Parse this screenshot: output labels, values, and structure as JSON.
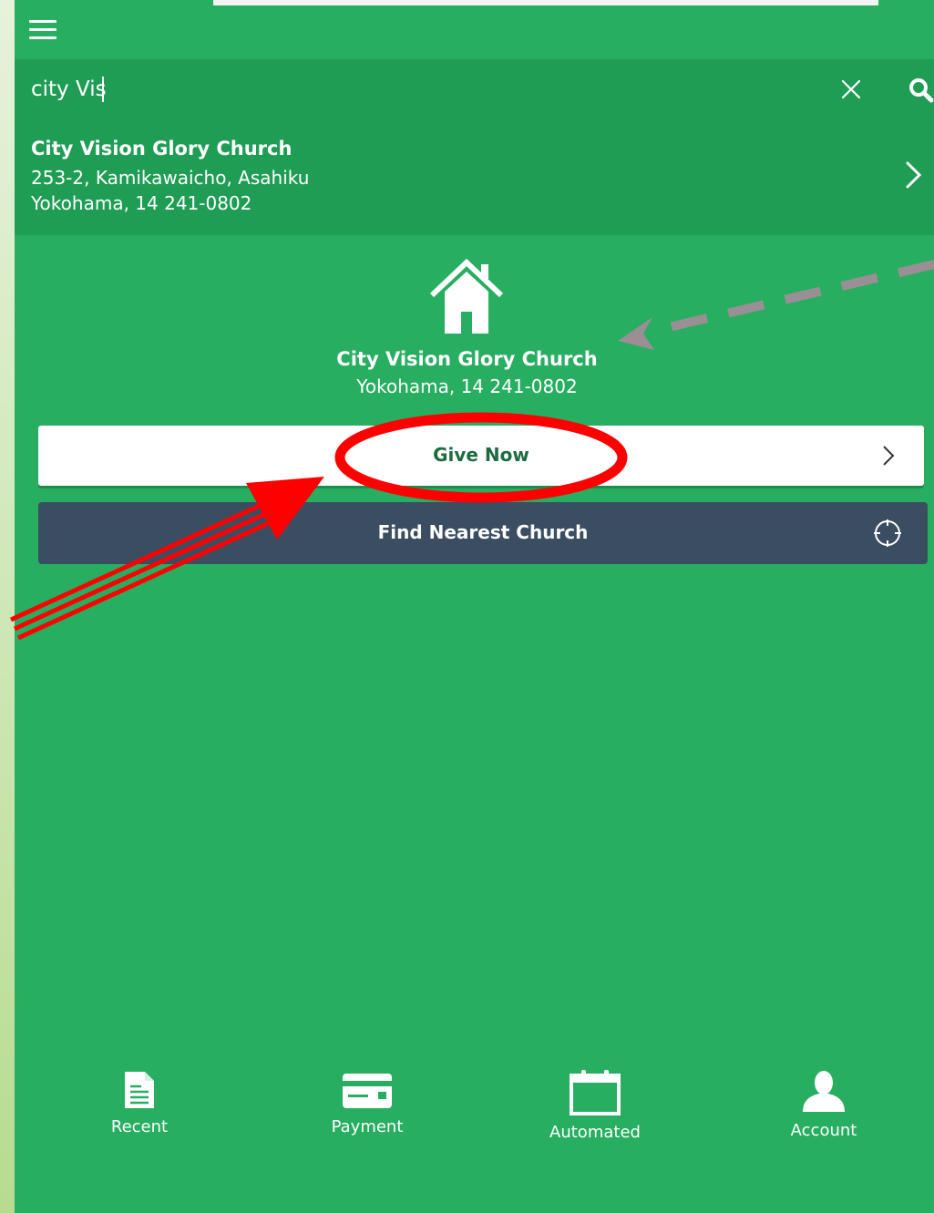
{
  "search": {
    "value": "city Vis",
    "placeholder": ""
  },
  "result": {
    "name": "City Vision Glory Church",
    "address_line1": "253-2, Kamikawaicho, Asahiku",
    "address_line2": "Yokohama, 14 241-0802"
  },
  "selected_church": {
    "name": "City Vision Glory Church",
    "city": "Yokohama, 14 241-0802"
  },
  "buttons": {
    "give_now": "Give Now",
    "find_nearest": "Find Nearest Church"
  },
  "tabs": [
    {
      "label": "Recent",
      "icon": "document-icon"
    },
    {
      "label": "Payment",
      "icon": "credit-card-icon"
    },
    {
      "label": "Automated",
      "icon": "calendar-icon"
    },
    {
      "label": "Account",
      "icon": "user-icon"
    }
  ],
  "colors": {
    "app_green": "#27ae60",
    "bar_green": "#1f9d55",
    "find_button": "#3a4d61",
    "annotation_red": "#ff0000",
    "annotation_grey_arrow": "#9a8f95"
  }
}
